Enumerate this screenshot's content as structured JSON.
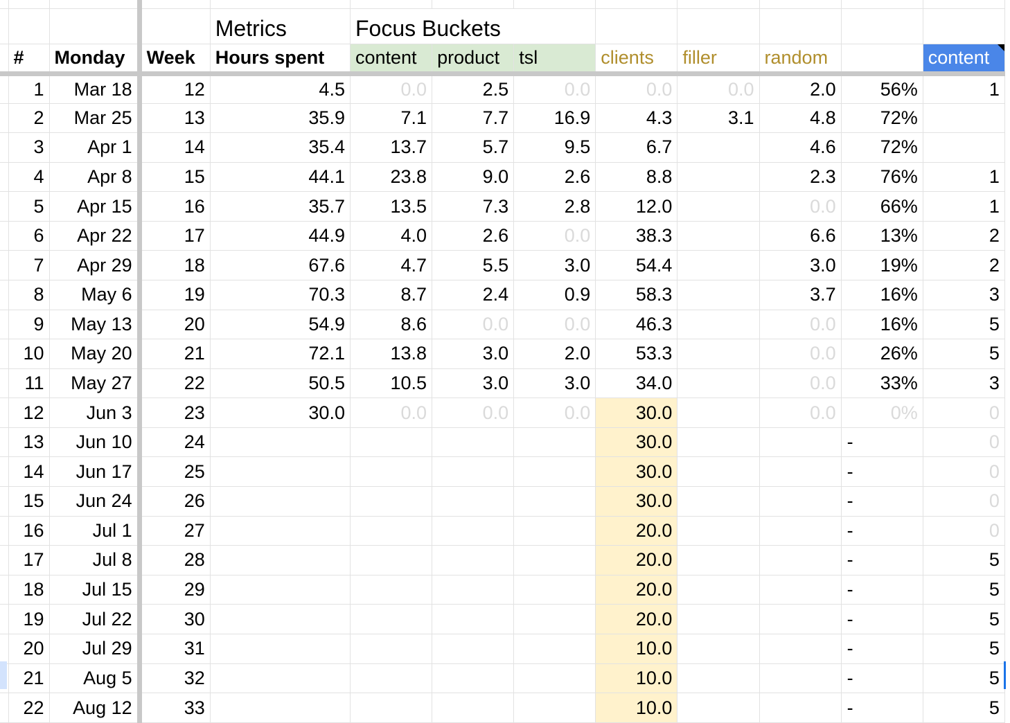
{
  "header": {
    "group_metrics": "Metrics",
    "group_focus": "Focus Buckets",
    "col_num": "#",
    "col_monday": "Monday",
    "col_week": "Week",
    "col_hours": "Hours spent",
    "col_content": "content",
    "col_product": "product",
    "col_tsl": "tsl",
    "col_clients": "clients",
    "col_filler": "filler",
    "col_random": "random",
    "col_pct": "",
    "col_content2": "content"
  },
  "rows": [
    [
      "1",
      "Mar 18",
      "12",
      "4.5",
      "0.0",
      "2.5",
      "0.0",
      "0.0",
      "0.0",
      "2.0",
      "56%",
      "1"
    ],
    [
      "2",
      "Mar 25",
      "13",
      "35.9",
      "7.1",
      "7.7",
      "16.9",
      "4.3",
      "3.1",
      "4.8",
      "72%",
      ""
    ],
    [
      "3",
      "Apr 1",
      "14",
      "35.4",
      "13.7",
      "5.7",
      "9.5",
      "6.7",
      "",
      "4.6",
      "72%",
      ""
    ],
    [
      "4",
      "Apr 8",
      "15",
      "44.1",
      "23.8",
      "9.0",
      "2.6",
      "8.8",
      "",
      "2.3",
      "76%",
      "1"
    ],
    [
      "5",
      "Apr 15",
      "16",
      "35.7",
      "13.5",
      "7.3",
      "2.8",
      "12.0",
      "",
      "0.0",
      "66%",
      "1"
    ],
    [
      "6",
      "Apr 22",
      "17",
      "44.9",
      "4.0",
      "2.6",
      "0.0",
      "38.3",
      "",
      "6.6",
      "13%",
      "2"
    ],
    [
      "7",
      "Apr 29",
      "18",
      "67.6",
      "4.7",
      "5.5",
      "3.0",
      "54.4",
      "",
      "3.0",
      "19%",
      "2"
    ],
    [
      "8",
      "May 6",
      "19",
      "70.3",
      "8.7",
      "2.4",
      "0.9",
      "58.3",
      "",
      "3.7",
      "16%",
      "3"
    ],
    [
      "9",
      "May 13",
      "20",
      "54.9",
      "8.6",
      "0.0",
      "0.0",
      "46.3",
      "",
      "0.0",
      "16%",
      "5"
    ],
    [
      "10",
      "May 20",
      "21",
      "72.1",
      "13.8",
      "3.0",
      "2.0",
      "53.3",
      "",
      "0.0",
      "26%",
      "5"
    ],
    [
      "11",
      "May 27",
      "22",
      "50.5",
      "10.5",
      "3.0",
      "3.0",
      "34.0",
      "",
      "0.0",
      "33%",
      "3"
    ],
    [
      "12",
      "Jun 3",
      "23",
      "30.0",
      "0.0",
      "0.0",
      "0.0",
      "30.0",
      "",
      "0.0",
      "0%",
      "0"
    ],
    [
      "13",
      "Jun 10",
      "24",
      "",
      "",
      "",
      "",
      "30.0",
      "",
      "",
      "-",
      "0"
    ],
    [
      "14",
      "Jun 17",
      "25",
      "",
      "",
      "",
      "",
      "30.0",
      "",
      "",
      "-",
      "0"
    ],
    [
      "15",
      "Jun 24",
      "26",
      "",
      "",
      "",
      "",
      "30.0",
      "",
      "",
      "-",
      "0"
    ],
    [
      "16",
      "Jul 1",
      "27",
      "",
      "",
      "",
      "",
      "20.0",
      "",
      "",
      "-",
      "0"
    ],
    [
      "17",
      "Jul 8",
      "28",
      "",
      "",
      "",
      "",
      "20.0",
      "",
      "",
      "-",
      "5"
    ],
    [
      "18",
      "Jul 15",
      "29",
      "",
      "",
      "",
      "",
      "20.0",
      "",
      "",
      "-",
      "5"
    ],
    [
      "19",
      "Jul 22",
      "30",
      "",
      "",
      "",
      "",
      "20.0",
      "",
      "",
      "-",
      "5"
    ],
    [
      "20",
      "Jul 29",
      "31",
      "",
      "",
      "",
      "",
      "10.0",
      "",
      "",
      "-",
      "5"
    ],
    [
      "21",
      "Aug 5",
      "32",
      "",
      "",
      "",
      "",
      "10.0",
      "",
      "",
      "-",
      "5"
    ],
    [
      "22",
      "Aug 12",
      "33",
      "",
      "",
      "",
      "",
      "10.0",
      "",
      "",
      "-",
      "5"
    ]
  ],
  "colors": {
    "focus_header_green": "#d9ead3",
    "clients_projection_yellow": "#fff2cc",
    "secondary_bucket_text": "#b08e2c",
    "selected_header_blue": "#4a86e8",
    "zero_value_gray": "#dadada"
  }
}
